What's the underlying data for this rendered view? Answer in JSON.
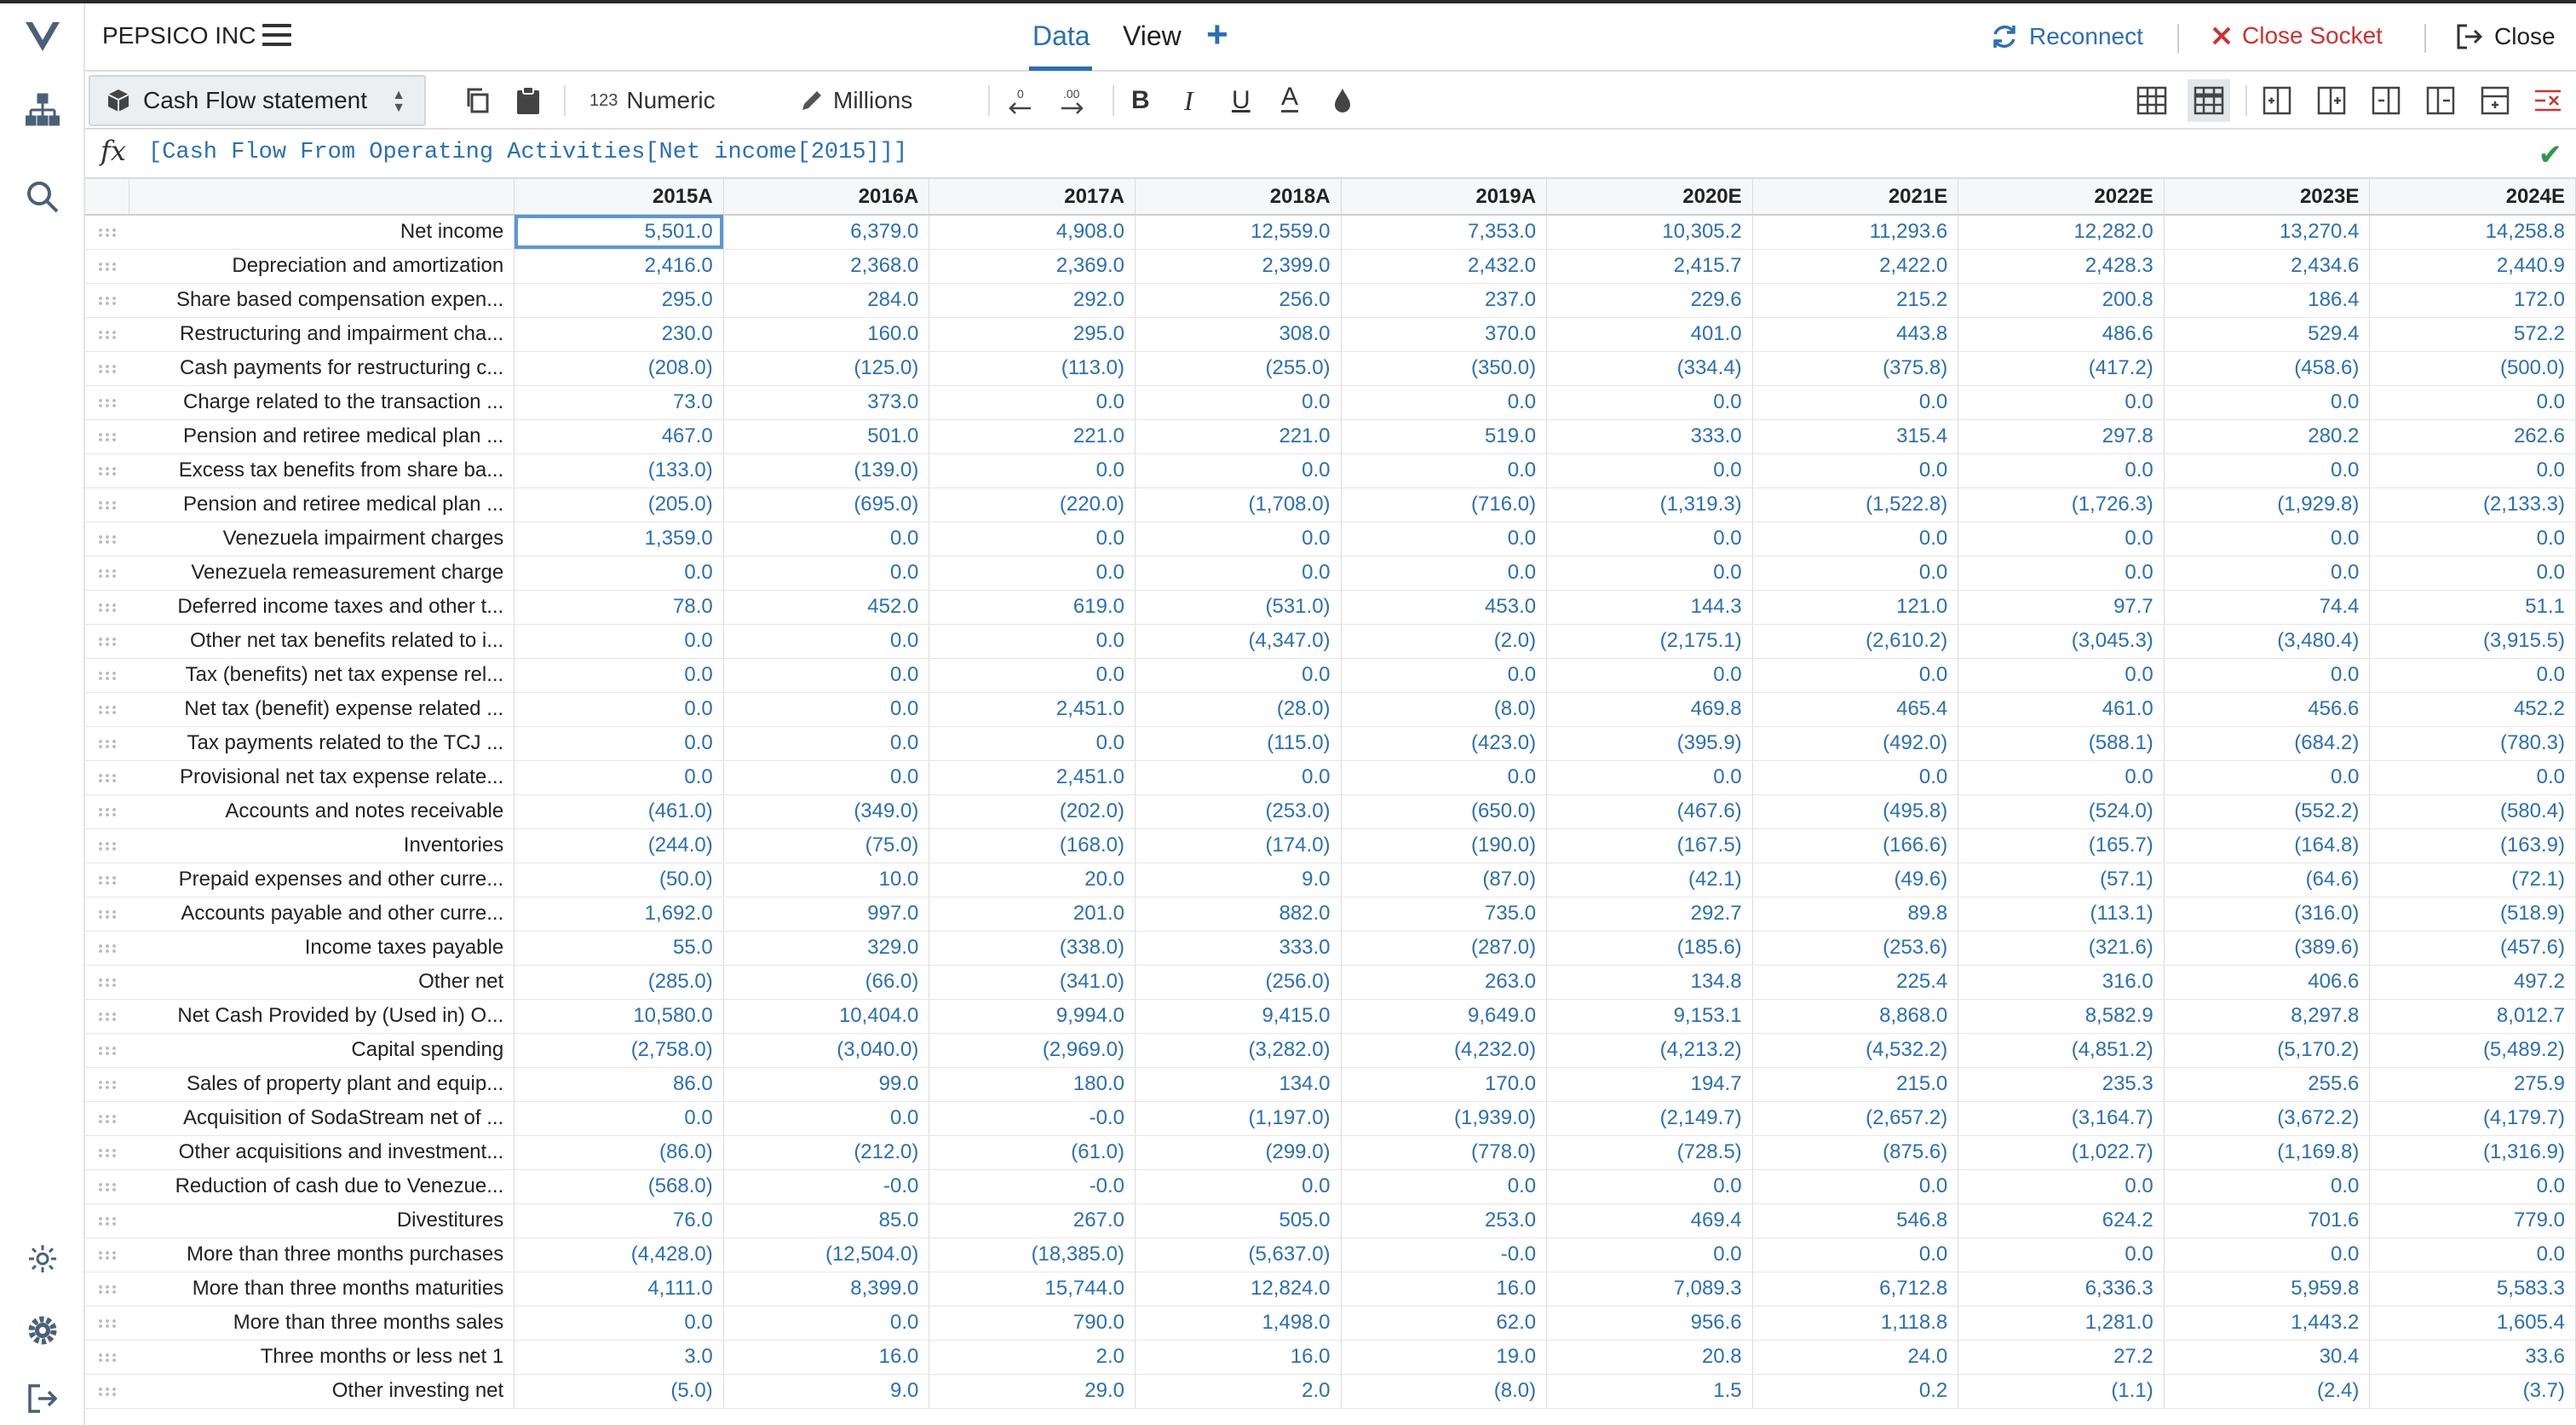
{
  "app": {
    "name": "PEPSICO INC"
  },
  "tabs": {
    "data": "Data",
    "view": "View",
    "add": "+"
  },
  "actions": {
    "reconnect": "Reconnect",
    "close_socket": "Close Socket",
    "close": "Close"
  },
  "toolbar": {
    "statement": "Cash Flow statement",
    "numeric_prefix": "123",
    "numeric": "Numeric",
    "units": "Millions",
    "dec_less": ".0",
    "dec_more": ".00",
    "bold": "B",
    "italic": "I",
    "underline": "U",
    "font_color": "A"
  },
  "formula": {
    "fx": "fx",
    "text": "[Cash Flow From Operating Activities[Net income[2015]]]"
  },
  "colors": {
    "accent": "#2a6fb5",
    "danger": "#d13030",
    "ok": "#2a9a4a"
  },
  "icons": {
    "logo": "v-logo-icon",
    "hierarchy": "hierarchy-icon",
    "search": "search-icon",
    "theme": "sun-icon",
    "settings": "gear-icon",
    "logout": "logout-icon"
  },
  "grid": {
    "columns": [
      "2015A",
      "2016A",
      "2017A",
      "2018A",
      "2019A",
      "2020E",
      "2021E",
      "2022E",
      "2023E",
      "2024E"
    ],
    "rows": [
      {
        "label": "Net income",
        "values": [
          "5,501.0",
          "6,379.0",
          "4,908.0",
          "12,559.0",
          "7,353.0",
          "10,305.2",
          "11,293.6",
          "12,282.0",
          "13,270.4",
          "14,258.8"
        ]
      },
      {
        "label": "Depreciation and amortization",
        "values": [
          "2,416.0",
          "2,368.0",
          "2,369.0",
          "2,399.0",
          "2,432.0",
          "2,415.7",
          "2,422.0",
          "2,428.3",
          "2,434.6",
          "2,440.9"
        ]
      },
      {
        "label": "Share based compensation expen...",
        "values": [
          "295.0",
          "284.0",
          "292.0",
          "256.0",
          "237.0",
          "229.6",
          "215.2",
          "200.8",
          "186.4",
          "172.0"
        ]
      },
      {
        "label": "Restructuring and impairment cha...",
        "values": [
          "230.0",
          "160.0",
          "295.0",
          "308.0",
          "370.0",
          "401.0",
          "443.8",
          "486.6",
          "529.4",
          "572.2"
        ]
      },
      {
        "label": "Cash payments for restructuring c...",
        "values": [
          "(208.0)",
          "(125.0)",
          "(113.0)",
          "(255.0)",
          "(350.0)",
          "(334.4)",
          "(375.8)",
          "(417.2)",
          "(458.6)",
          "(500.0)"
        ]
      },
      {
        "label": "Charge related to the transaction ...",
        "values": [
          "73.0",
          "373.0",
          "0.0",
          "0.0",
          "0.0",
          "0.0",
          "0.0",
          "0.0",
          "0.0",
          "0.0"
        ]
      },
      {
        "label": "Pension and retiree medical plan ...",
        "values": [
          "467.0",
          "501.0",
          "221.0",
          "221.0",
          "519.0",
          "333.0",
          "315.4",
          "297.8",
          "280.2",
          "262.6"
        ]
      },
      {
        "label": "Excess tax benefits from share ba...",
        "values": [
          "(133.0)",
          "(139.0)",
          "0.0",
          "0.0",
          "0.0",
          "0.0",
          "0.0",
          "0.0",
          "0.0",
          "0.0"
        ]
      },
      {
        "label": "Pension and retiree medical plan ...",
        "values": [
          "(205.0)",
          "(695.0)",
          "(220.0)",
          "(1,708.0)",
          "(716.0)",
          "(1,319.3)",
          "(1,522.8)",
          "(1,726.3)",
          "(1,929.8)",
          "(2,133.3)"
        ]
      },
      {
        "label": "Venezuela impairment charges",
        "values": [
          "1,359.0",
          "0.0",
          "0.0",
          "0.0",
          "0.0",
          "0.0",
          "0.0",
          "0.0",
          "0.0",
          "0.0"
        ]
      },
      {
        "label": "Venezuela remeasurement charge",
        "values": [
          "0.0",
          "0.0",
          "0.0",
          "0.0",
          "0.0",
          "0.0",
          "0.0",
          "0.0",
          "0.0",
          "0.0"
        ]
      },
      {
        "label": "Deferred income taxes and other t...",
        "values": [
          "78.0",
          "452.0",
          "619.0",
          "(531.0)",
          "453.0",
          "144.3",
          "121.0",
          "97.7",
          "74.4",
          "51.1"
        ]
      },
      {
        "label": "Other net tax benefits related to i...",
        "values": [
          "0.0",
          "0.0",
          "0.0",
          "(4,347.0)",
          "(2.0)",
          "(2,175.1)",
          "(2,610.2)",
          "(3,045.3)",
          "(3,480.4)",
          "(3,915.5)"
        ]
      },
      {
        "label": "Tax (benefits) net tax expense rel...",
        "values": [
          "0.0",
          "0.0",
          "0.0",
          "0.0",
          "0.0",
          "0.0",
          "0.0",
          "0.0",
          "0.0",
          "0.0"
        ]
      },
      {
        "label": "Net tax (benefit) expense related ...",
        "values": [
          "0.0",
          "0.0",
          "2,451.0",
          "(28.0)",
          "(8.0)",
          "469.8",
          "465.4",
          "461.0",
          "456.6",
          "452.2"
        ]
      },
      {
        "label": "Tax payments related to the TCJ ...",
        "values": [
          "0.0",
          "0.0",
          "0.0",
          "(115.0)",
          "(423.0)",
          "(395.9)",
          "(492.0)",
          "(588.1)",
          "(684.2)",
          "(780.3)"
        ]
      },
      {
        "label": "Provisional net tax expense relate...",
        "values": [
          "0.0",
          "0.0",
          "2,451.0",
          "0.0",
          "0.0",
          "0.0",
          "0.0",
          "0.0",
          "0.0",
          "0.0"
        ]
      },
      {
        "label": "Accounts and notes receivable",
        "values": [
          "(461.0)",
          "(349.0)",
          "(202.0)",
          "(253.0)",
          "(650.0)",
          "(467.6)",
          "(495.8)",
          "(524.0)",
          "(552.2)",
          "(580.4)"
        ]
      },
      {
        "label": "Inventories",
        "values": [
          "(244.0)",
          "(75.0)",
          "(168.0)",
          "(174.0)",
          "(190.0)",
          "(167.5)",
          "(166.6)",
          "(165.7)",
          "(164.8)",
          "(163.9)"
        ]
      },
      {
        "label": "Prepaid expenses and other curre...",
        "values": [
          "(50.0)",
          "10.0",
          "20.0",
          "9.0",
          "(87.0)",
          "(42.1)",
          "(49.6)",
          "(57.1)",
          "(64.6)",
          "(72.1)"
        ]
      },
      {
        "label": "Accounts payable and other curre...",
        "values": [
          "1,692.0",
          "997.0",
          "201.0",
          "882.0",
          "735.0",
          "292.7",
          "89.8",
          "(113.1)",
          "(316.0)",
          "(518.9)"
        ]
      },
      {
        "label": "Income taxes payable",
        "values": [
          "55.0",
          "329.0",
          "(338.0)",
          "333.0",
          "(287.0)",
          "(185.6)",
          "(253.6)",
          "(321.6)",
          "(389.6)",
          "(457.6)"
        ]
      },
      {
        "label": "Other net",
        "values": [
          "(285.0)",
          "(66.0)",
          "(341.0)",
          "(256.0)",
          "263.0",
          "134.8",
          "225.4",
          "316.0",
          "406.6",
          "497.2"
        ]
      },
      {
        "label": "Net Cash Provided by (Used in) O...",
        "values": [
          "10,580.0",
          "10,404.0",
          "9,994.0",
          "9,415.0",
          "9,649.0",
          "9,153.1",
          "8,868.0",
          "8,582.9",
          "8,297.8",
          "8,012.7"
        ]
      },
      {
        "label": "Capital spending",
        "values": [
          "(2,758.0)",
          "(3,040.0)",
          "(2,969.0)",
          "(3,282.0)",
          "(4,232.0)",
          "(4,213.2)",
          "(4,532.2)",
          "(4,851.2)",
          "(5,170.2)",
          "(5,489.2)"
        ]
      },
      {
        "label": "Sales of property plant and equip...",
        "values": [
          "86.0",
          "99.0",
          "180.0",
          "134.0",
          "170.0",
          "194.7",
          "215.0",
          "235.3",
          "255.6",
          "275.9"
        ]
      },
      {
        "label": "Acquisition of SodaStream net of ...",
        "values": [
          "0.0",
          "0.0",
          "-0.0",
          "(1,197.0)",
          "(1,939.0)",
          "(2,149.7)",
          "(2,657.2)",
          "(3,164.7)",
          "(3,672.2)",
          "(4,179.7)"
        ]
      },
      {
        "label": "Other acquisitions and investment...",
        "values": [
          "(86.0)",
          "(212.0)",
          "(61.0)",
          "(299.0)",
          "(778.0)",
          "(728.5)",
          "(875.6)",
          "(1,022.7)",
          "(1,169.8)",
          "(1,316.9)"
        ]
      },
      {
        "label": "Reduction of cash due to Venezue...",
        "values": [
          "(568.0)",
          "-0.0",
          "-0.0",
          "0.0",
          "0.0",
          "0.0",
          "0.0",
          "0.0",
          "0.0",
          "0.0"
        ]
      },
      {
        "label": "Divestitures",
        "values": [
          "76.0",
          "85.0",
          "267.0",
          "505.0",
          "253.0",
          "469.4",
          "546.8",
          "624.2",
          "701.6",
          "779.0"
        ]
      },
      {
        "label": "More than three months purchases",
        "values": [
          "(4,428.0)",
          "(12,504.0)",
          "(18,385.0)",
          "(5,637.0)",
          "-0.0",
          "0.0",
          "0.0",
          "0.0",
          "0.0",
          "0.0"
        ]
      },
      {
        "label": "More than three months maturities",
        "values": [
          "4,111.0",
          "8,399.0",
          "15,744.0",
          "12,824.0",
          "16.0",
          "7,089.3",
          "6,712.8",
          "6,336.3",
          "5,959.8",
          "5,583.3"
        ]
      },
      {
        "label": "More than three months sales",
        "values": [
          "0.0",
          "0.0",
          "790.0",
          "1,498.0",
          "62.0",
          "956.6",
          "1,118.8",
          "1,281.0",
          "1,443.2",
          "1,605.4"
        ]
      },
      {
        "label": "Three months or less net 1",
        "values": [
          "3.0",
          "16.0",
          "2.0",
          "16.0",
          "19.0",
          "20.8",
          "24.0",
          "27.2",
          "30.4",
          "33.6"
        ]
      },
      {
        "label": "Other investing net",
        "values": [
          "(5.0)",
          "9.0",
          "29.0",
          "2.0",
          "(8.0)",
          "1.5",
          "0.2",
          "(1.1)",
          "(2.4)",
          "(3.7)"
        ]
      }
    ]
  }
}
